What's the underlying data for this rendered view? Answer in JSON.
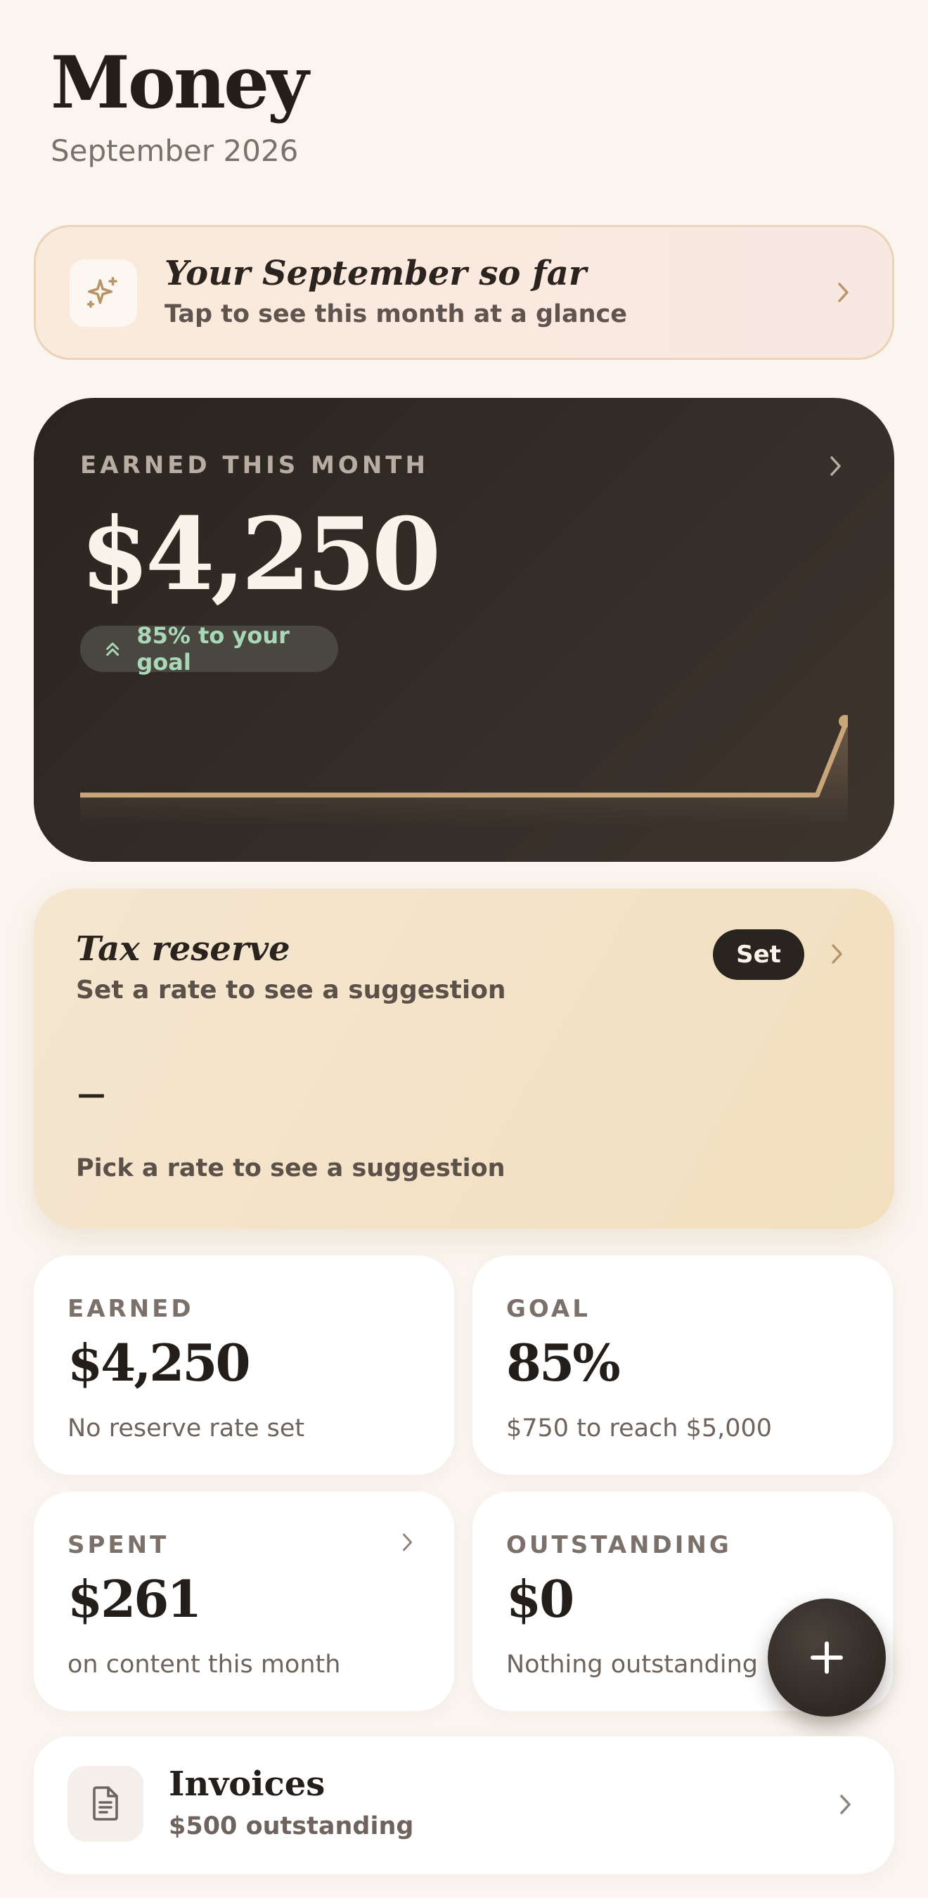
{
  "header": {
    "title": "Money",
    "subtitle": "September 2026"
  },
  "summary": {
    "title": "Your September so far",
    "subtitle": "Tap to see this month at a glance",
    "icon": "sparkles-icon"
  },
  "earned": {
    "label": "EARNED THIS MONTH",
    "amount": "$4,250",
    "goal_pill": "85% to your goal",
    "trend_fraction_points": [
      0,
      0,
      0,
      0,
      0,
      0,
      0,
      0,
      0,
      0,
      0,
      0,
      0,
      0,
      0,
      0,
      0,
      0,
      0,
      0,
      0,
      0,
      0,
      0,
      0,
      1
    ]
  },
  "tax": {
    "title": "Tax reserve",
    "subtitle": "Set a rate to see a suggestion",
    "button": "Set",
    "value": "—",
    "footnote": "Pick a rate to see a suggestion"
  },
  "stats": {
    "earned": {
      "label": "EARNED",
      "value": "$4,250",
      "sub": "No reserve rate set"
    },
    "goal": {
      "label": "GOAL",
      "value": "85%",
      "sub": "$750 to reach $5,000"
    },
    "spent": {
      "label": "SPENT",
      "value": "$261",
      "sub": "on content this month"
    },
    "outstanding": {
      "label": "OUTSTANDING",
      "value": "$0",
      "sub": "Nothing outstanding"
    }
  },
  "invoices": {
    "title": "Invoices",
    "subtitle": "$500 outstanding",
    "icon": "document-icon"
  },
  "colors": {
    "background": "#faf5ef",
    "dark_card": "#2f2924",
    "accent_gold": "#c9a57a",
    "goal_green": "#a9d8b8"
  }
}
